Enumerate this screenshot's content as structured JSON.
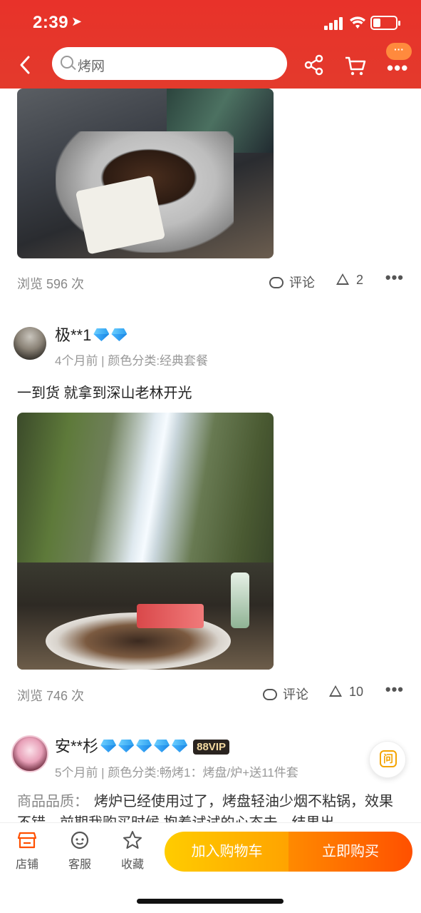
{
  "status_bar": {
    "time": "2:39",
    "location_arrow": "➤"
  },
  "header": {
    "back_icon": "‹",
    "search_value": "烤网",
    "more_badge": "···",
    "more_dots": "•••",
    "colors": {
      "bar": "#e8322a"
    }
  },
  "review1": {
    "views": "浏览 596 次",
    "comment_label": "评论",
    "likes": "2",
    "more": "•••"
  },
  "review2": {
    "username": "极**1",
    "meta": "4个月前 | 颜色分类:经典套餐",
    "text": "一到货 就拿到深山老林开光",
    "views": "浏览 746 次",
    "comment_label": "评论",
    "likes": "10",
    "more": "•••",
    "diamonds": 2
  },
  "review3": {
    "username": "安**杉",
    "vip": "88VIP",
    "diamonds": 5,
    "meta": "5个月前 | 颜色分类:畅烤1：烤盘/炉+送11件套",
    "label": "商品品质：",
    "text": "烤炉已经使用过了，烤盘轻油少烟不粘锅，效果不错，前期我购买时候 抱着试试的心态去，结果出"
  },
  "ask_button": "问",
  "bottom_bar": {
    "store": "店铺",
    "service": "客服",
    "favorite": "收藏",
    "add_to_cart": "加入购物车",
    "buy_now": "立即购买",
    "colors": {
      "cart": "#ffb800",
      "buy": "#ff5000"
    }
  }
}
